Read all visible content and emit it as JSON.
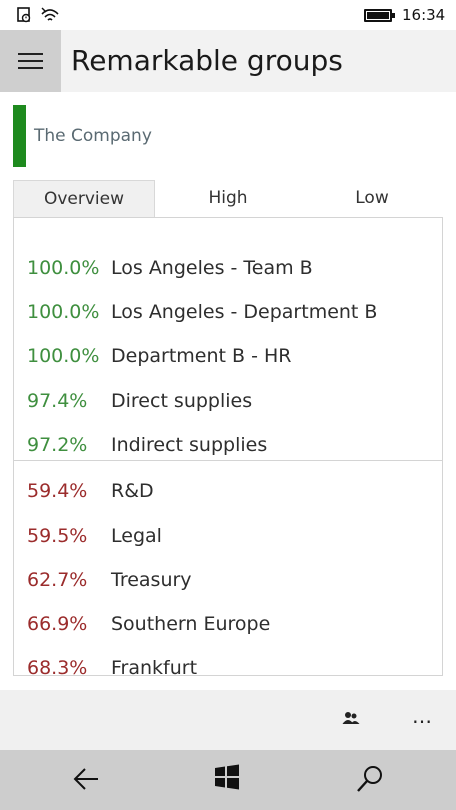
{
  "status": {
    "time": "16:34"
  },
  "header": {
    "title": "Remarkable groups"
  },
  "company": {
    "name": "The Company",
    "color": "#1e8a1e"
  },
  "tabs": [
    {
      "label": "Overview",
      "active": true
    },
    {
      "label": "High",
      "active": false
    },
    {
      "label": "Low",
      "active": false
    }
  ],
  "high": [
    {
      "pct": "100.0%",
      "label": "Los Angeles - Team B"
    },
    {
      "pct": "100.0%",
      "label": "Los Angeles - Department B"
    },
    {
      "pct": "100.0%",
      "label": "Department B - HR"
    },
    {
      "pct": "97.4%",
      "label": "Direct supplies"
    },
    {
      "pct": "97.2%",
      "label": "Indirect supplies"
    }
  ],
  "low": [
    {
      "pct": "59.4%",
      "label": "R&D"
    },
    {
      "pct": "59.5%",
      "label": "Legal"
    },
    {
      "pct": "62.7%",
      "label": "Treasury"
    },
    {
      "pct": "66.9%",
      "label": "Southern Europe"
    },
    {
      "pct": "68.3%",
      "label": "Frankfurt"
    }
  ],
  "appbar": {
    "more": "…"
  },
  "colors": {
    "high": "#3f8f3f",
    "low": "#9b2c2c",
    "accent": "#1e8a1e"
  }
}
